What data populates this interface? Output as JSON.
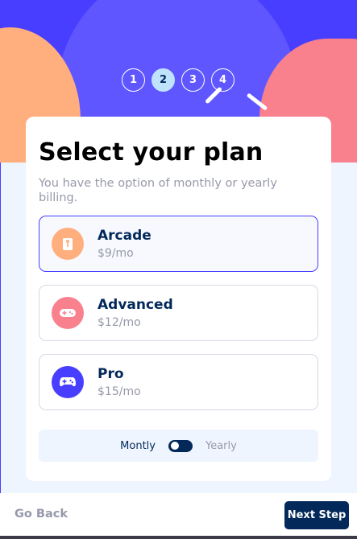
{
  "steps": [
    {
      "number": "1"
    },
    {
      "number": "2"
    },
    {
      "number": "3"
    },
    {
      "number": "4"
    }
  ],
  "active_step": "2",
  "form": {
    "title": "Select your plan",
    "subtitle": "You have the option of monthly or yearly billing."
  },
  "plans": [
    {
      "name": "Arcade",
      "price": "$9/mo",
      "icon": "arcade-icon",
      "color": "#ffaf7e",
      "selected": true
    },
    {
      "name": "Advanced",
      "price": "$12/mo",
      "icon": "gamepad-icon",
      "color": "#f9818e",
      "selected": false
    },
    {
      "name": "Pro",
      "price": "$15/mo",
      "icon": "controller-icon",
      "color": "#483eff",
      "selected": false
    }
  ],
  "billing": {
    "monthly_label": "Montly",
    "yearly_label": "Yearly",
    "selected": "monthly"
  },
  "footer": {
    "back_label": "Go Back",
    "next_label": "Next Step"
  },
  "colors": {
    "accent": "#483eff",
    "marine_blue": "#02295a",
    "cool_gray": "#9699ab"
  }
}
